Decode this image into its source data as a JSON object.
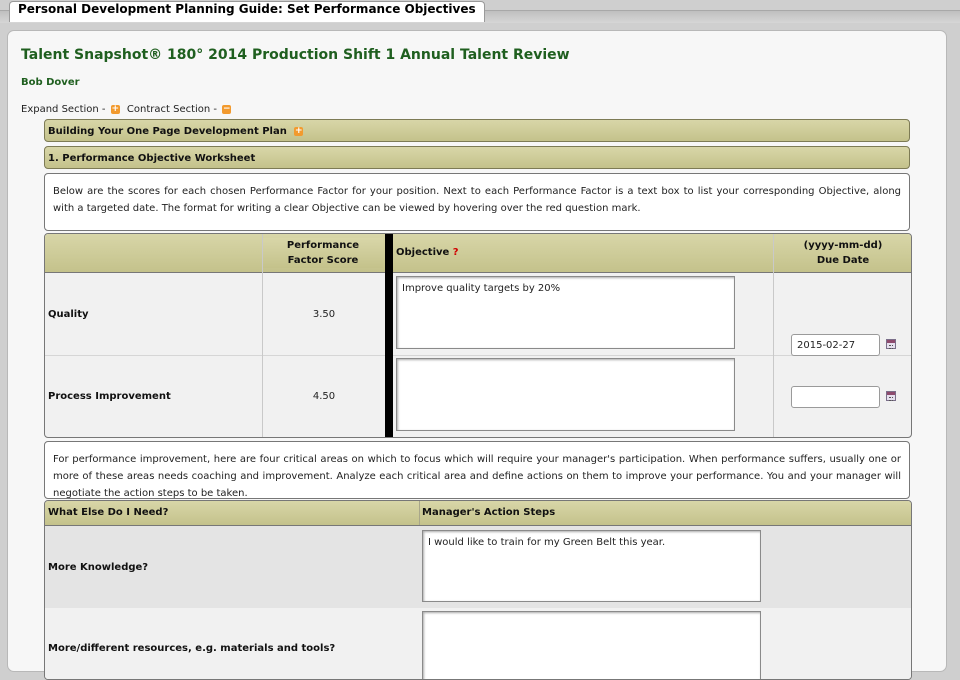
{
  "window": {
    "tab_title": "Personal Development Planning Guide: Set Performance Objectives"
  },
  "page": {
    "review_title": "Talent Snapshot® 180° 2014 Production Shift 1 Annual Talent Review",
    "employee_name": "Bob Dover",
    "expand_label": "Expand Section -",
    "contract_label": "Contract Section -"
  },
  "sections": {
    "plan_header": "Building Your One Page Development Plan",
    "worksheet_header": "1. Performance Objective Worksheet",
    "worksheet_intro": "Below are the scores for each chosen Performance Factor for your position. Next to each Performance Factor is a text box to list your corresponding Objective, along with a targeted date. The format for writing a clear Objective can be viewed by hovering over the red question mark."
  },
  "objectives_table": {
    "col_score_line1": "Performance",
    "col_score_line2": "Factor Score",
    "col_objective": "Objective",
    "objective_help": "?",
    "col_date_line1": "(yyyy-mm-dd)",
    "col_date_line2": "Due Date",
    "rows": [
      {
        "factor": "Quality",
        "score": "3.50",
        "objective": "Improve quality targets by 20%",
        "due_date": "2015-02-27"
      },
      {
        "factor": "Process Improvement",
        "score": "4.50",
        "objective": "",
        "due_date": ""
      }
    ]
  },
  "improvement": {
    "intro": "For performance improvement, here are four critical areas on which to focus which will require your manager's participation. When performance suffers, usually one or more of these areas needs coaching and improvement. Analyze each critical area and define actions on them to improve your performance. You and your manager will negotiate the action steps to be taken.",
    "col_need": "What Else Do I Need?",
    "col_actions": "Manager's Action Steps",
    "rows": [
      {
        "need": "More Knowledge?",
        "action": "I would like to train for my Green Belt this year."
      },
      {
        "need": "More/different resources, e.g. materials and tools?",
        "action": ""
      }
    ]
  },
  "colors": {
    "header_bar": "#c9c79a",
    "title_green": "#1f5f1f",
    "help_red": "#d00000",
    "expand_icon": "#f29a2e"
  }
}
